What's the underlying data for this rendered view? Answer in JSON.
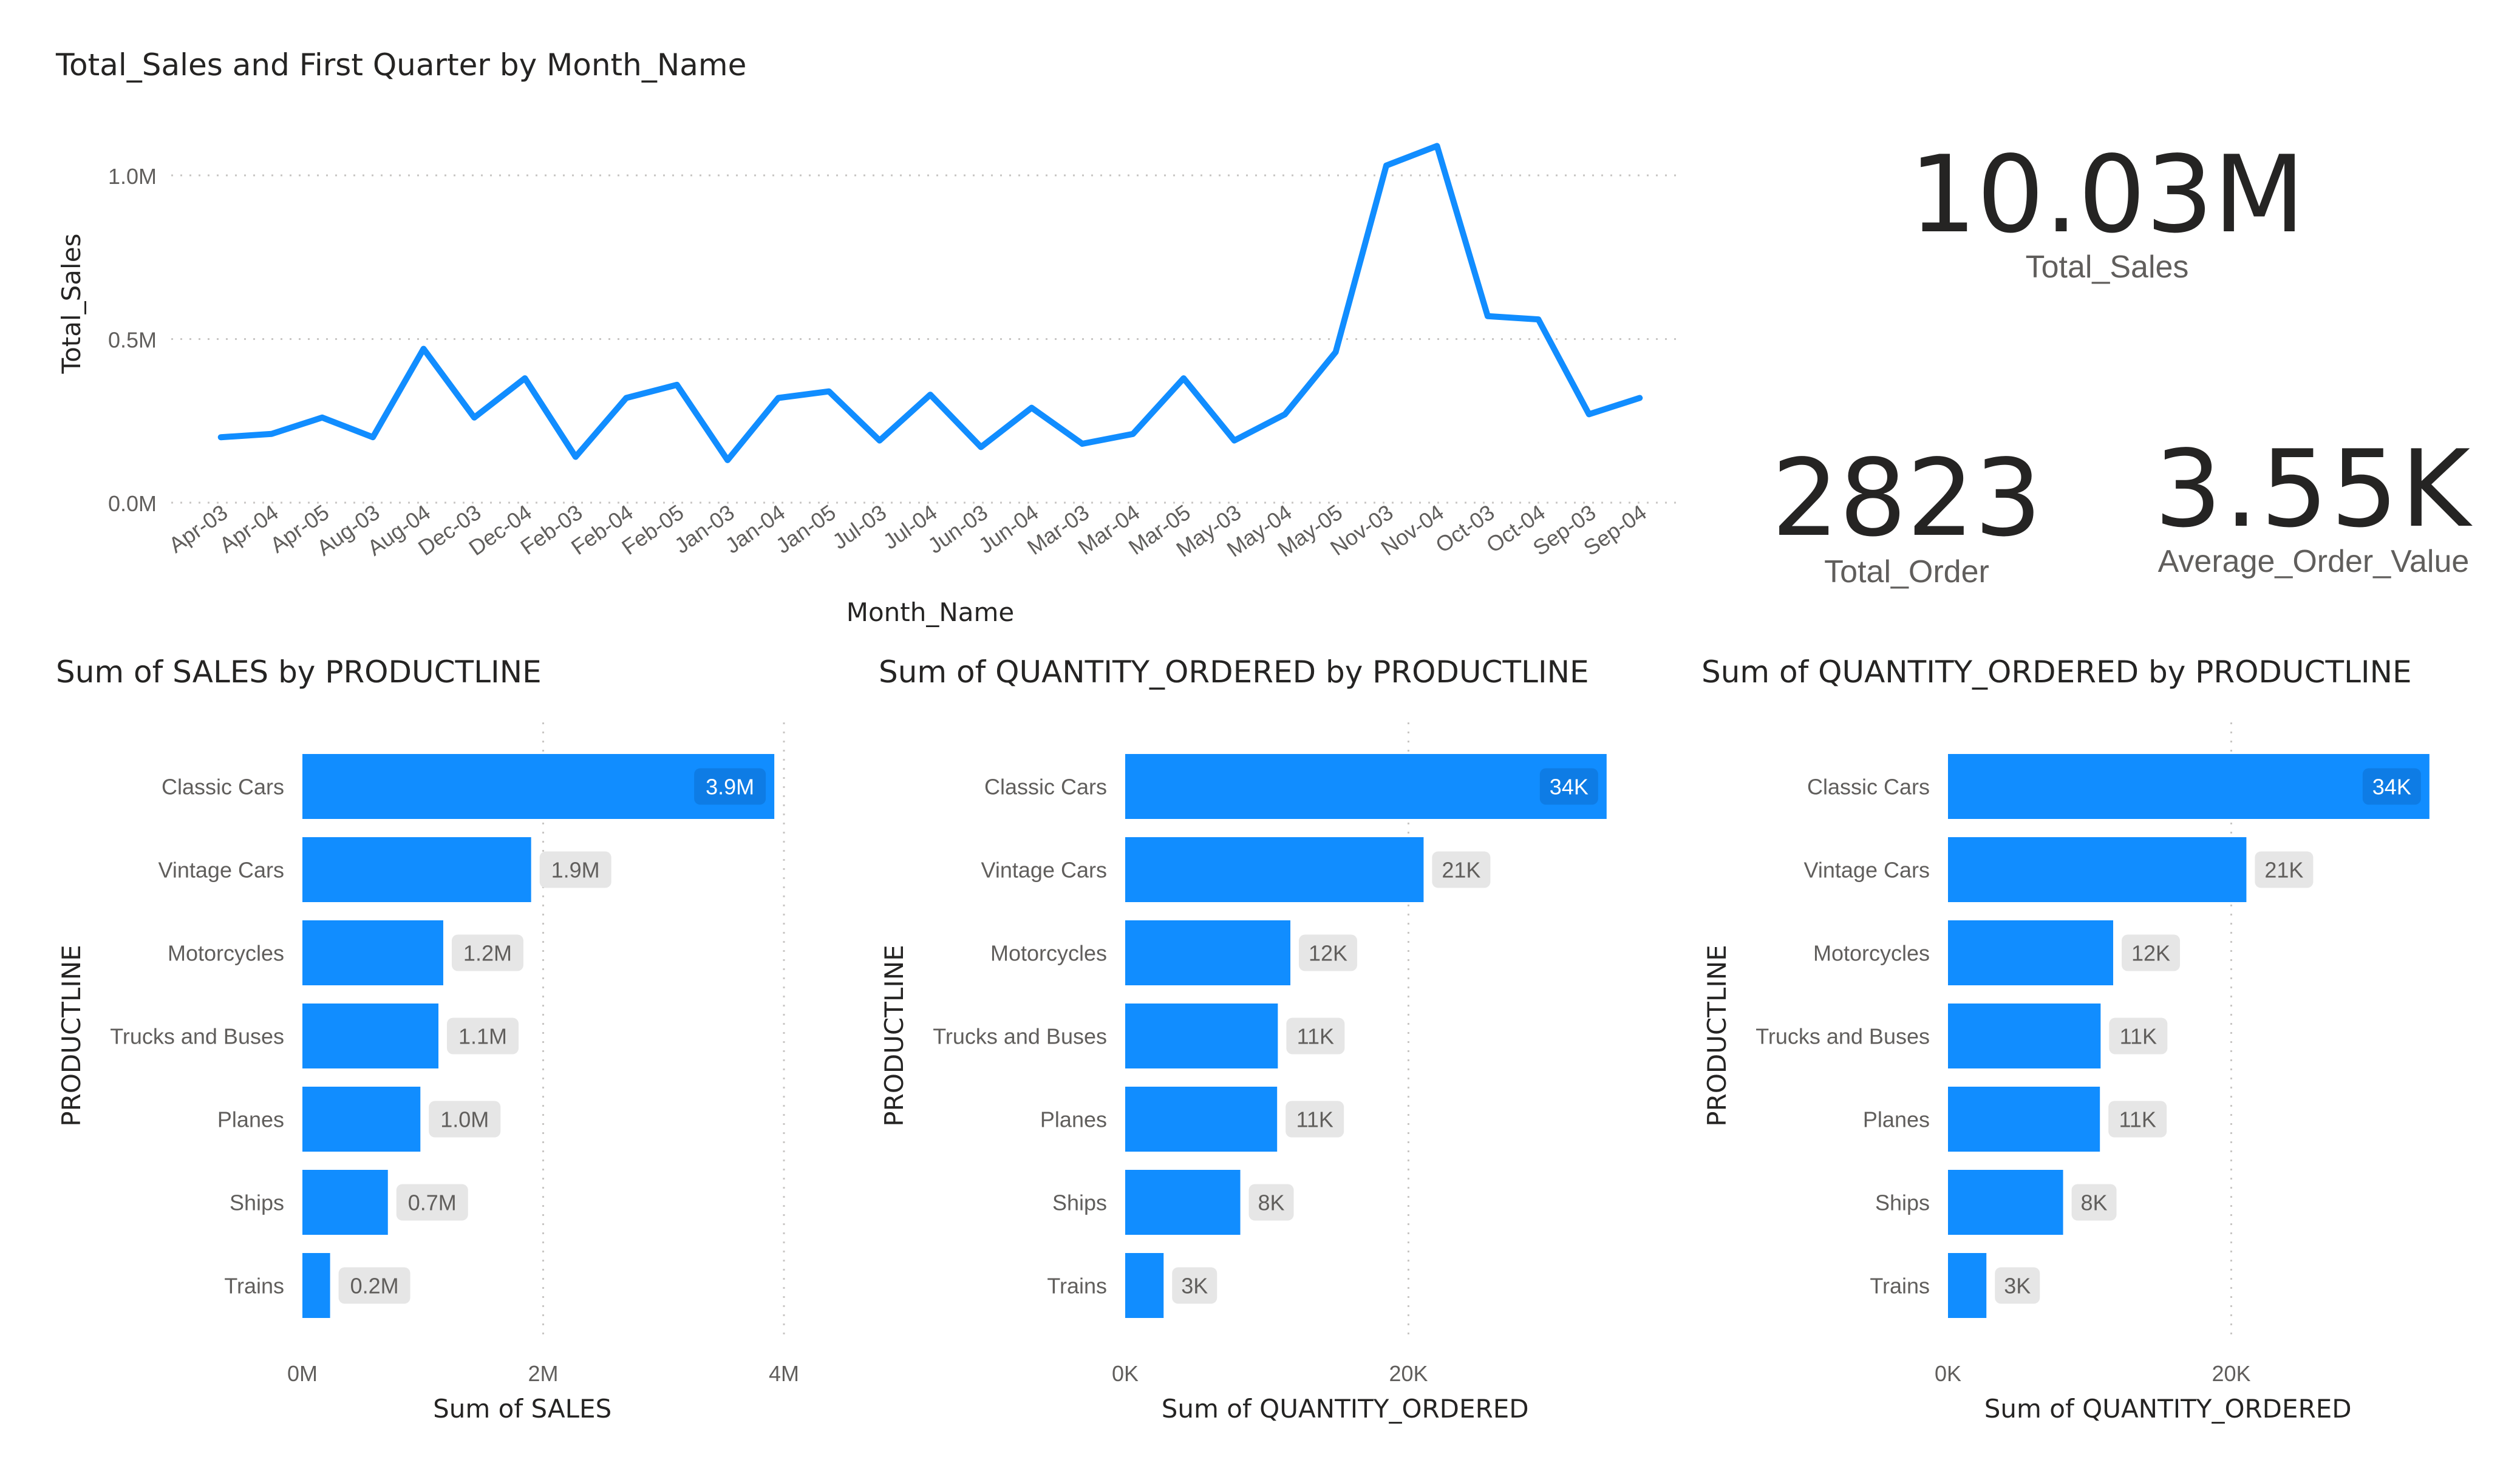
{
  "colors": {
    "series": "#118DFF",
    "grid": "#c8c6c4",
    "axis_text": "#605e5c",
    "title_text": "#252423",
    "label_bg": "#e6e6e6",
    "label_text_inside": "#ffffff",
    "label_text_outside": "#605e5c"
  },
  "kpis": {
    "total_sales": {
      "value": "10.03M",
      "label": "Total_Sales"
    },
    "total_order": {
      "value": "2823",
      "label": "Total_Order"
    },
    "avg_order_value": {
      "value": "3.55K",
      "label": "Average_Order_Value"
    }
  },
  "chart_data": [
    {
      "type": "line",
      "title": "Total_Sales and First Quarter by Month_Name",
      "xlabel": "Month_Name",
      "ylabel": "Total_Sales",
      "ylim": [
        0,
        1.1
      ],
      "yticks": [
        0,
        0.5,
        1.0
      ],
      "yticklabels": [
        "0.0M",
        "0.5M",
        "1.0M"
      ],
      "grid": true,
      "categories": [
        "Apr-03",
        "Apr-04",
        "Apr-05",
        "Aug-03",
        "Aug-04",
        "Dec-03",
        "Dec-04",
        "Feb-03",
        "Feb-04",
        "Feb-05",
        "Jan-03",
        "Jan-04",
        "Jan-05",
        "Jul-03",
        "Jul-04",
        "Jun-03",
        "Jun-04",
        "Mar-03",
        "Mar-04",
        "Mar-05",
        "May-03",
        "May-04",
        "May-05",
        "Nov-03",
        "Nov-04",
        "Oct-03",
        "Oct-04",
        "Sep-03",
        "Sep-04"
      ],
      "series": [
        {
          "values": [
            0.2,
            0.21,
            0.26,
            0.2,
            0.47,
            0.26,
            0.38,
            0.14,
            0.32,
            0.36,
            0.13,
            0.32,
            0.34,
            0.19,
            0.33,
            0.17,
            0.29,
            0.18,
            0.21,
            0.38,
            0.19,
            0.27,
            0.46,
            1.03,
            1.09,
            0.57,
            0.56,
            0.27,
            0.32
          ]
        }
      ]
    },
    {
      "type": "bar",
      "orientation": "horizontal",
      "title": "Sum of SALES by PRODUCTLINE",
      "xlabel": "Sum of SALES",
      "ylabel": "PRODUCTLINE",
      "xlim": [
        0,
        4
      ],
      "xticks": [
        0,
        2,
        4
      ],
      "xticklabels": [
        "0M",
        "2M",
        "4M"
      ],
      "grid": true,
      "categories": [
        "Classic Cars",
        "Vintage Cars",
        "Motorcycles",
        "Trucks and Buses",
        "Planes",
        "Ships",
        "Trains"
      ],
      "values": [
        3.92,
        1.9,
        1.17,
        1.13,
        0.98,
        0.71,
        0.23
      ],
      "data_labels": [
        "3.9M",
        "1.9M",
        "1.2M",
        "1.1M",
        "1.0M",
        "0.7M",
        "0.2M"
      ]
    },
    {
      "type": "bar",
      "orientation": "horizontal",
      "title": "Sum of QUANTITY_ORDERED by PRODUCTLINE",
      "xlabel": "Sum of QUANTITY_ORDERED",
      "ylabel": "PRODUCTLINE",
      "xlim": [
        0,
        34000
      ],
      "xticks": [
        0,
        20000
      ],
      "xticklabels": [
        "0K",
        "20K"
      ],
      "grid": true,
      "categories": [
        "Classic Cars",
        "Vintage Cars",
        "Motorcycles",
        "Trucks and Buses",
        "Planes",
        "Ships",
        "Trains"
      ],
      "values": [
        33992,
        21069,
        11663,
        10777,
        10727,
        8127,
        2712
      ],
      "data_labels": [
        "34K",
        "21K",
        "12K",
        "11K",
        "11K",
        "8K",
        "3K"
      ]
    },
    {
      "type": "bar",
      "orientation": "horizontal",
      "title": "Sum of QUANTITY_ORDERED by PRODUCTLINE",
      "xlabel": "Sum of QUANTITY_ORDERED",
      "ylabel": "PRODUCTLINE",
      "xlim": [
        0,
        34000
      ],
      "xticks": [
        0,
        20000
      ],
      "xticklabels": [
        "0K",
        "20K"
      ],
      "grid": true,
      "categories": [
        "Classic Cars",
        "Vintage Cars",
        "Motorcycles",
        "Trucks and Buses",
        "Planes",
        "Ships",
        "Trains"
      ],
      "values": [
        33992,
        21069,
        11663,
        10777,
        10727,
        8127,
        2712
      ],
      "data_labels": [
        "34K",
        "21K",
        "12K",
        "11K",
        "11K",
        "8K",
        "3K"
      ]
    }
  ]
}
